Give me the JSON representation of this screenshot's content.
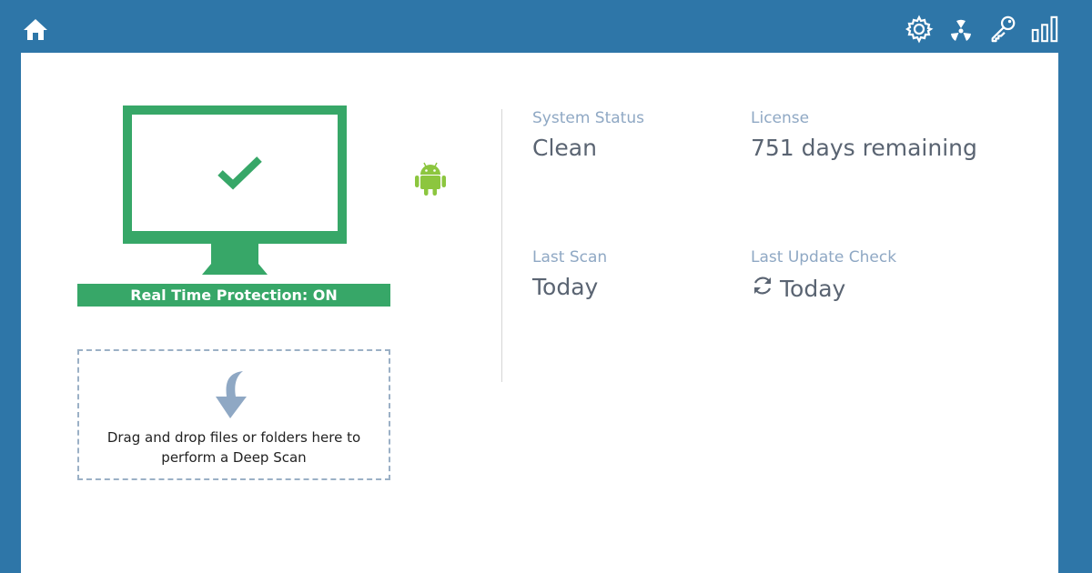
{
  "toolbar": {
    "icons": [
      "home-icon",
      "gear-icon",
      "radiation-icon",
      "key-icon",
      "bar-chart-icon"
    ],
    "color": "#ffffff"
  },
  "colors": {
    "frame": "#2e76a8",
    "accent_green": "#37a768",
    "android_green": "#8cc63f",
    "label_blue": "#8fa8c4"
  },
  "protection": {
    "status_icon": "check-icon",
    "label": "Real Time Protection: ON"
  },
  "dropzone": {
    "icon": "down-arrow-icon",
    "line1": "Drag and drop files or folders here to",
    "line2": "perform a Deep Scan"
  },
  "status": {
    "system_status": {
      "label": "System Status",
      "value": "Clean"
    },
    "license": {
      "label": "License",
      "value": "751 days remaining"
    },
    "last_scan": {
      "label": "Last Scan",
      "value": "Today"
    },
    "last_update": {
      "label": "Last Update Check",
      "value": "Today",
      "icon": "refresh-icon"
    }
  }
}
